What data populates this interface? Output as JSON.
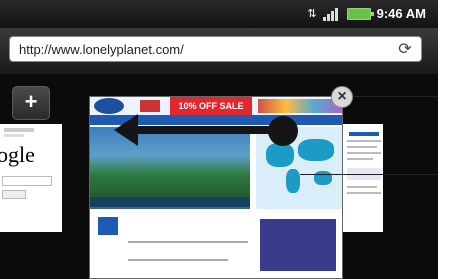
{
  "status": {
    "time": "9:46 AM"
  },
  "browser": {
    "url": "http://www.lonelyplanet.com/"
  },
  "tabs": {
    "new_tab": "+",
    "close": "×"
  },
  "thumbnail": {
    "sale_banner": "10% OFF SALE"
  },
  "left_thumb_text": "ogle",
  "colors": {
    "battery": "#6cc04a",
    "sale": "#e1282e"
  }
}
